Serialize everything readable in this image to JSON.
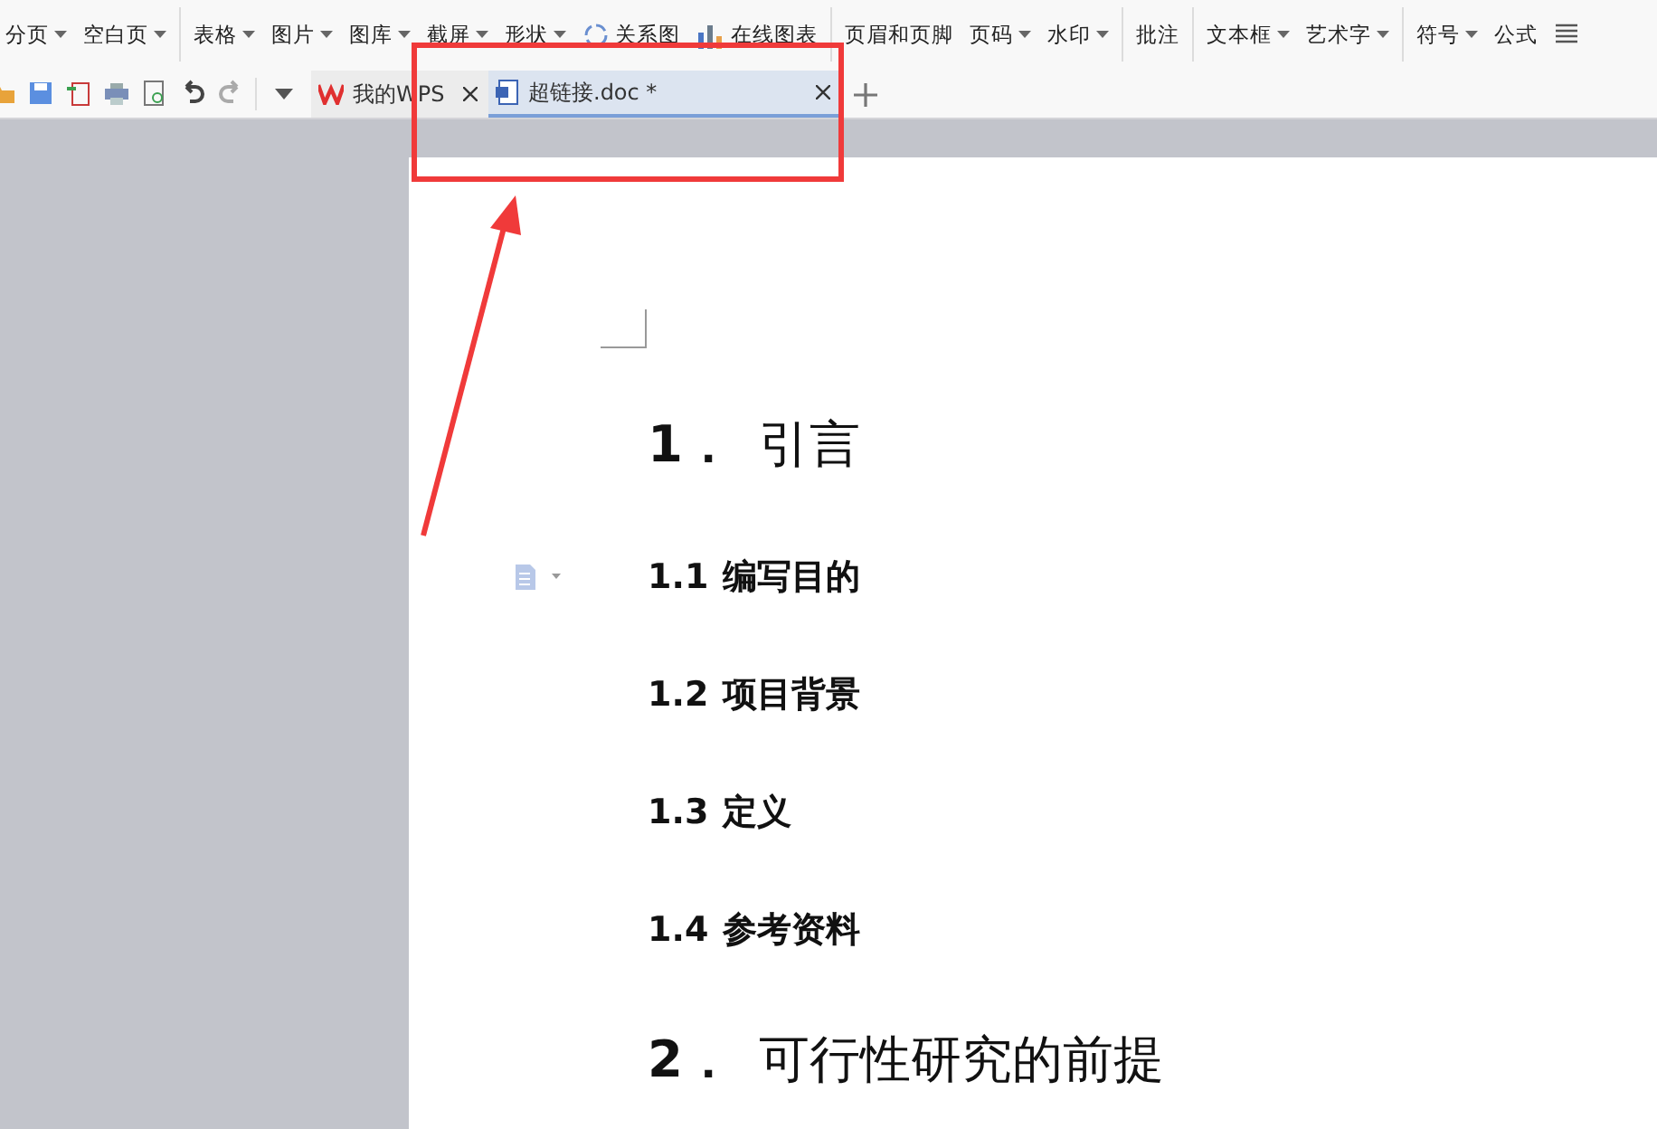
{
  "ribbon": {
    "groups": [
      {
        "items": [
          {
            "label": "分页",
            "dropdown": true
          },
          {
            "label": "空白页",
            "dropdown": true
          }
        ]
      },
      {
        "items": [
          {
            "label": "表格",
            "dropdown": true
          },
          {
            "label": "图片",
            "dropdown": true
          },
          {
            "label": "图库",
            "dropdown": true
          },
          {
            "label": "截屏",
            "dropdown": true
          },
          {
            "label": "形状",
            "dropdown": true
          },
          {
            "label": "关系图",
            "dropdown": false,
            "kind": "relation"
          },
          {
            "label": "在线图表",
            "dropdown": false,
            "kind": "chart"
          }
        ]
      },
      {
        "items": [
          {
            "label": "页眉和页脚",
            "dropdown": false
          },
          {
            "label": "页码",
            "dropdown": true
          },
          {
            "label": "水印",
            "dropdown": true
          }
        ]
      },
      {
        "items": [
          {
            "label": "批注",
            "dropdown": false
          }
        ]
      },
      {
        "items": [
          {
            "label": "文本框",
            "dropdown": true
          },
          {
            "label": "艺术字",
            "dropdown": true
          }
        ]
      },
      {
        "items": [
          {
            "label": "符号",
            "dropdown": true
          },
          {
            "label": "公式",
            "dropdown": false
          },
          {
            "dropdown": false,
            "kind": "more"
          }
        ]
      }
    ]
  },
  "tabs": [
    {
      "label": "我的WPS",
      "kind": "home",
      "selected": false
    },
    {
      "label": "超链接.doc *",
      "kind": "doc",
      "selected": true
    }
  ],
  "document": {
    "headings": [
      {
        "kind": "h1",
        "number": "1．",
        "text": "引言"
      },
      {
        "kind": "h2",
        "number": "1.1",
        "text": "编写目的"
      },
      {
        "kind": "h2",
        "number": "1.2",
        "text": "项目背景"
      },
      {
        "kind": "h2",
        "number": "1.3",
        "text": "定义"
      },
      {
        "kind": "h2",
        "number": "1.4",
        "text": "参考资料"
      },
      {
        "kind": "h1",
        "number": "2．",
        "text": "可行性研究的前提"
      }
    ]
  }
}
